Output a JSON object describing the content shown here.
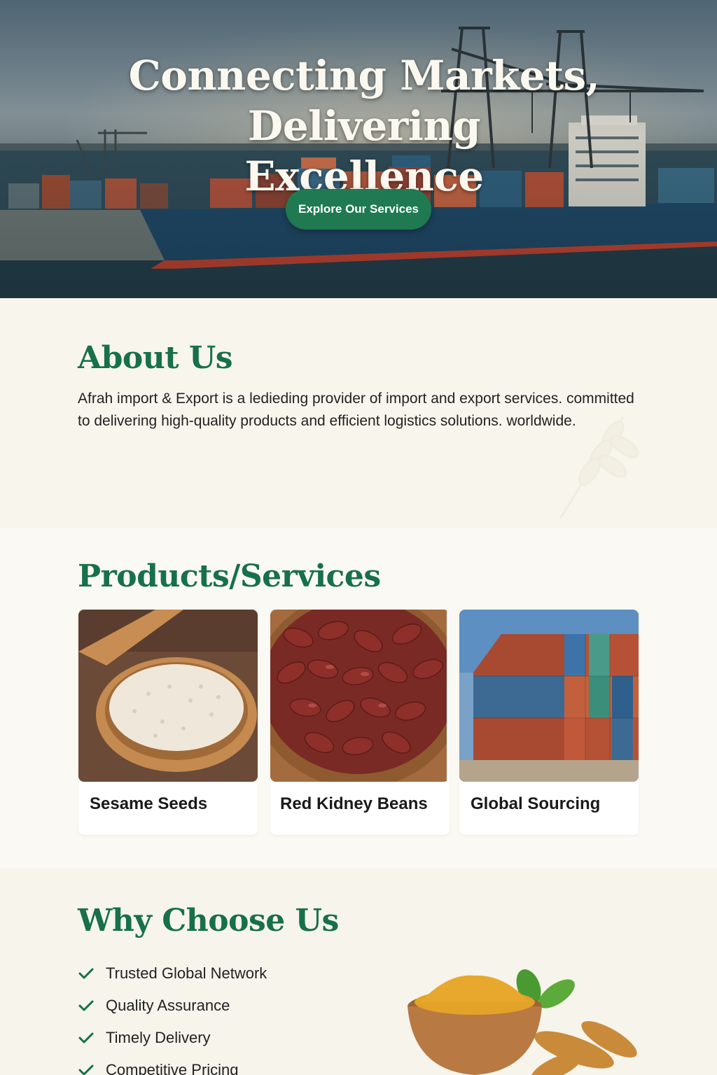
{
  "hero": {
    "title_line1": "Connecting Markets,",
    "title_line2": "Delivering Excellence",
    "cta_label": "Explore Our Services"
  },
  "about": {
    "title": "About Us",
    "text": "Afrah import & Export is a ledieding provider of import and export services. committed to delivering high-quality products and efficient logistics solutions. worldwide."
  },
  "products": {
    "title": "Products/Services",
    "items": [
      {
        "label": "Sesame Seeds",
        "icon": "sesame-seeds-image"
      },
      {
        "label": "Red Kidney Beans",
        "icon": "kidney-beans-image"
      },
      {
        "label": "Global Sourcing",
        "icon": "shipping-containers-image"
      }
    ]
  },
  "why": {
    "title": "Why Choose Us",
    "items": [
      "Trusted Global Network",
      "Quality Assurance",
      "Timely Delivery",
      "Competitive Pricing"
    ]
  },
  "colors": {
    "brand_green": "#17704a",
    "button_green": "#1f7a52",
    "background": "#f8f5ec"
  }
}
